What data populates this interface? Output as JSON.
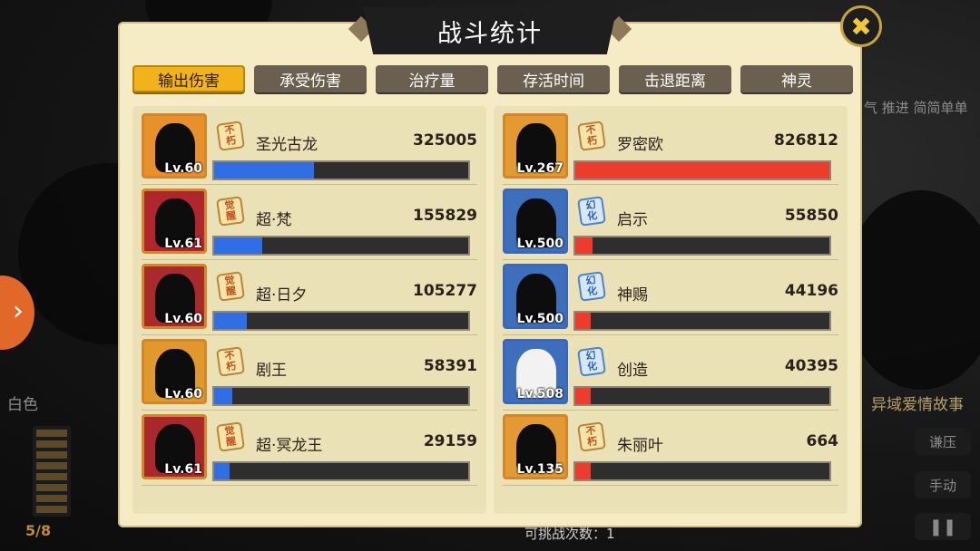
{
  "title": "战斗统计",
  "close_icon": "close-x-icon",
  "tabs": [
    {
      "label": "输出伤害",
      "active": true
    },
    {
      "label": "承受伤害",
      "active": false
    },
    {
      "label": "治疗量",
      "active": false
    },
    {
      "label": "存活时间",
      "active": false
    },
    {
      "label": "击退距离",
      "active": false
    },
    {
      "label": "神灵",
      "active": false
    }
  ],
  "left_team": {
    "bar_color": "#2f6ee4",
    "heroes": [
      {
        "name": "圣光古龙",
        "value": "325005",
        "level": "Lv.60",
        "badge": "不朽",
        "share": 0.393,
        "avatar_icon": "dragon-portrait-icon"
      },
      {
        "name": "超·梵",
        "value": "155829",
        "level": "Lv.61",
        "badge": "觉醒",
        "share": 0.188,
        "avatar_icon": "armored-warrior-portrait-icon"
      },
      {
        "name": "超·日夕",
        "value": "105277",
        "level": "Lv.60",
        "badge": "觉醒",
        "share": 0.127,
        "avatar_icon": "masked-hero-portrait-icon"
      },
      {
        "name": "剧王",
        "value": "58391",
        "level": "Lv.60",
        "badge": "不朽",
        "share": 0.071,
        "avatar_icon": "dark-king-portrait-icon"
      },
      {
        "name": "超·冥龙王",
        "value": "29159",
        "level": "Lv.61",
        "badge": "觉醒",
        "share": 0.035,
        "avatar_icon": "dragon-king-portrait-icon"
      }
    ]
  },
  "right_team": {
    "bar_color": "#ee3c2c",
    "heroes": [
      {
        "name": "罗密欧",
        "value": "826812",
        "level": "Lv.267",
        "badge": "不朽",
        "share": 1.0,
        "avatar_icon": "helmet-knight-portrait-icon"
      },
      {
        "name": "启示",
        "value": "55850",
        "level": "Lv.500",
        "badge": "幻化",
        "share": 0.068,
        "avatar_icon": "beast-portrait-icon"
      },
      {
        "name": "神赐",
        "value": "44196",
        "level": "Lv.500",
        "badge": "幻化",
        "share": 0.053,
        "avatar_icon": "cat-mask-portrait-icon"
      },
      {
        "name": "创造",
        "value": "40395",
        "level": "Lv.508",
        "badge": "幻化",
        "share": 0.049,
        "avatar_icon": "hooded-figure-portrait-icon"
      },
      {
        "name": "朱丽叶",
        "value": "664",
        "level": "Lv.135",
        "badge": "不朽",
        "share": 0.001,
        "avatar_icon": "crowned-queen-portrait-icon"
      }
    ]
  },
  "background": {
    "left_label": "白色",
    "right_label": "异域爱情故事",
    "right_top_text": "气 推进 简简单单",
    "energy": "5/8",
    "btn_auto": "谦压",
    "btn_manual": "手动",
    "bottom_text": "可挑战次数：1",
    "pause_icon": "pause-icon",
    "arrow_icon": "chevron-right-icon"
  }
}
